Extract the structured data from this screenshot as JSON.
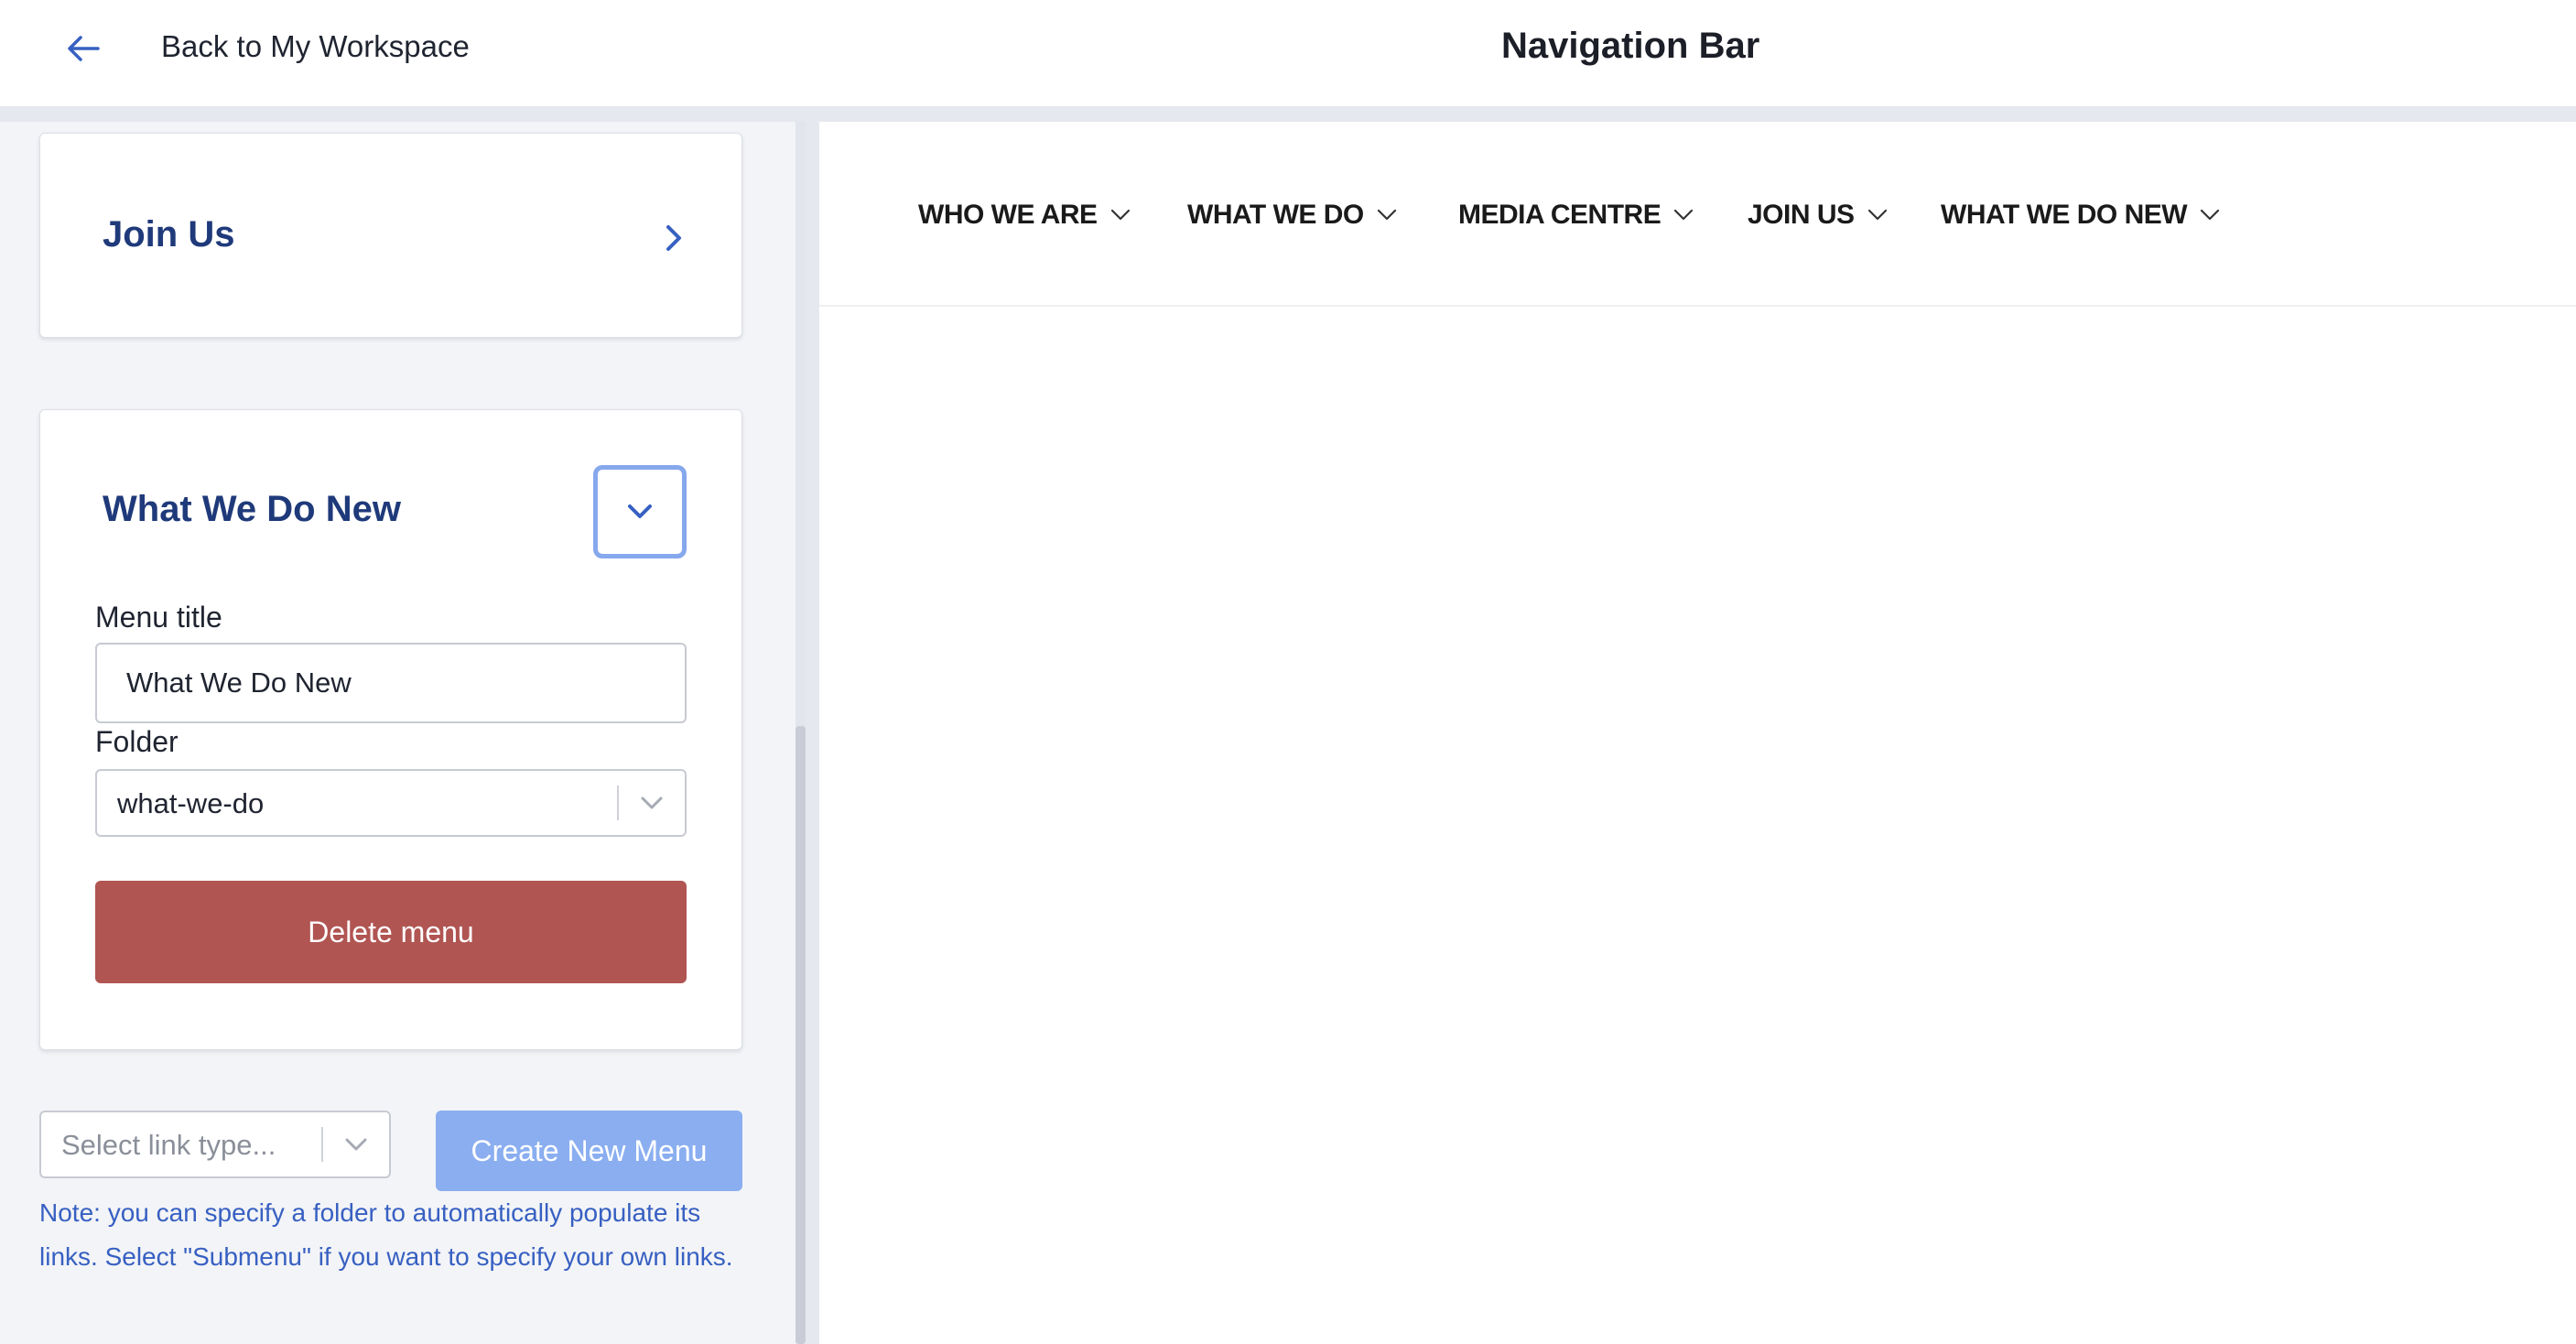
{
  "header": {
    "back_label": "Back to My Workspace",
    "title": "Navigation Bar",
    "back_icon": "arrow-left-icon"
  },
  "sidebar": {
    "cards": [
      {
        "title": "Join Us",
        "state": "collapsed",
        "icon": "chevron-right-icon"
      },
      {
        "title": "What We Do New",
        "state": "expanded",
        "icon": "chevron-down-icon",
        "menu_title_label": "Menu title",
        "menu_title_value": "What We Do New",
        "folder_label": "Folder",
        "folder_value": "what-we-do",
        "delete_label": "Delete menu"
      }
    ],
    "link_type_placeholder": "Select link type...",
    "create_label": "Create New Menu",
    "note": "Note: you can specify a folder to automatically populate its links. Select \"Submenu\" if you want to specify your own links."
  },
  "preview": {
    "nav_items": [
      {
        "label": "WHO WE ARE"
      },
      {
        "label": "WHAT WE DO"
      },
      {
        "label": "MEDIA CENTRE"
      },
      {
        "label": "JOIN US"
      },
      {
        "label": "WHAT WE DO NEW"
      }
    ]
  },
  "colors": {
    "accent": "#3760c2",
    "card_title": "#1f3a7a",
    "danger": "#b05552",
    "primary_disabled": "#8aaef0",
    "focus_ring": "#86a8ec"
  }
}
